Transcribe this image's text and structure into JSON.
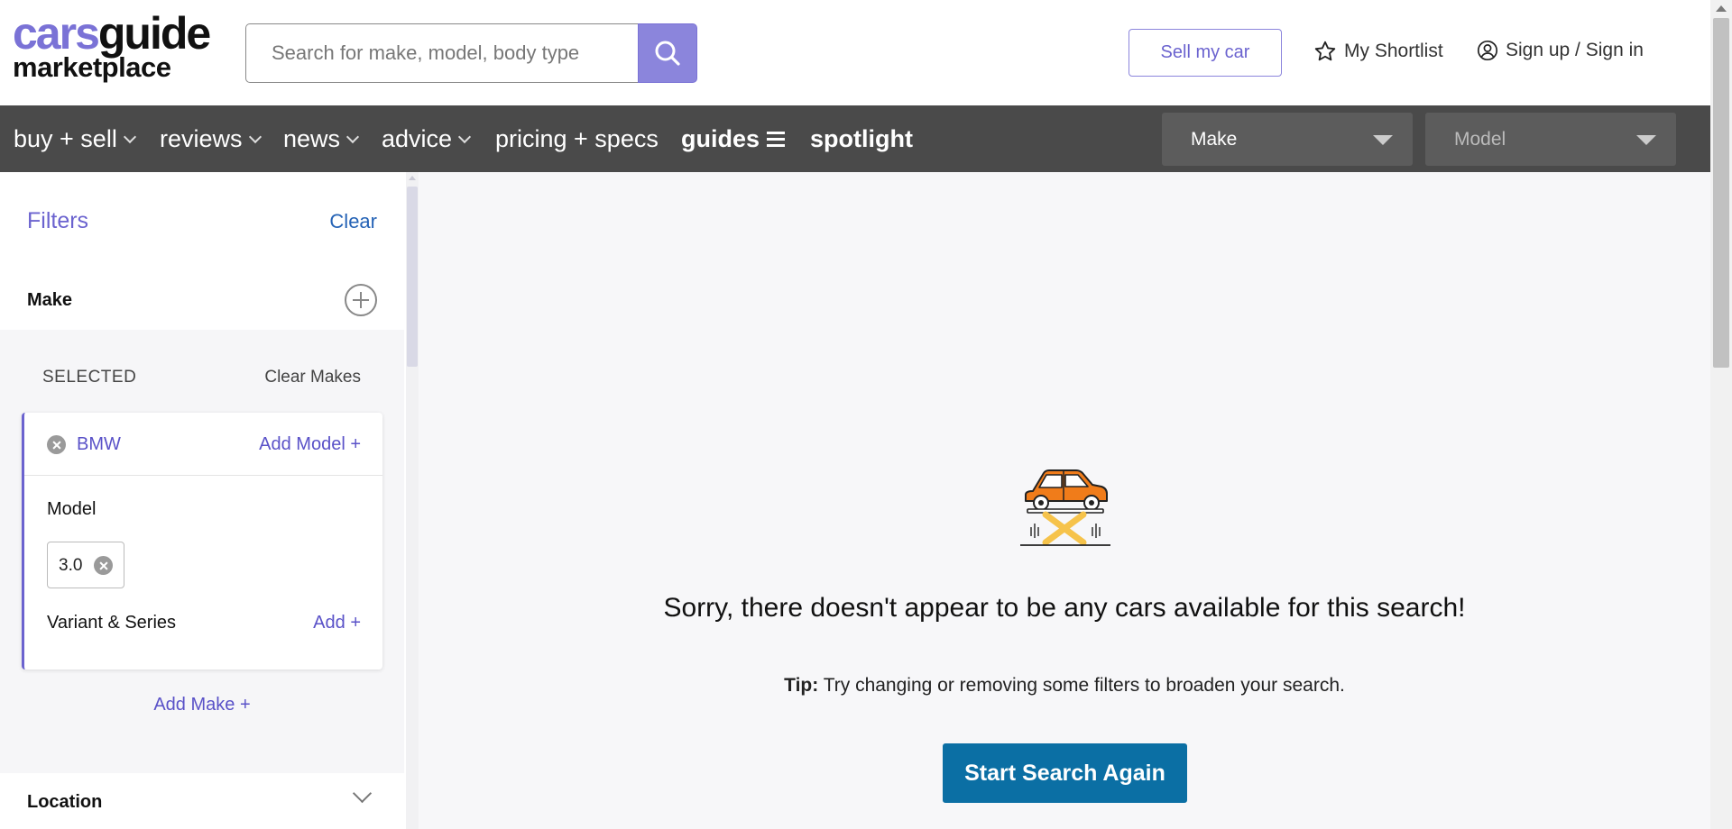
{
  "logo": {
    "part1": "cars",
    "part2": "guide",
    "line2": "marketplace"
  },
  "search": {
    "placeholder": "Search for make, model, body type"
  },
  "header": {
    "sell_label": "Sell my car",
    "shortlist_label": "My Shortlist",
    "signin_label": "Sign up / Sign in"
  },
  "nav": {
    "items": [
      {
        "label": "buy + sell"
      },
      {
        "label": "reviews"
      },
      {
        "label": "news"
      },
      {
        "label": "advice"
      },
      {
        "label": "pricing + specs"
      },
      {
        "label": "guides"
      },
      {
        "label": "spotlight"
      }
    ],
    "make_select": "Make",
    "model_select": "Model"
  },
  "sidebar": {
    "title": "Filters",
    "clear": "Clear",
    "make_label": "Make",
    "selected_label": "SELECTED",
    "clear_makes": "Clear Makes",
    "make_card": {
      "make": "BMW",
      "add_model": "Add Model +",
      "model_title": "Model",
      "model_chip": "3.0",
      "variant_label": "Variant & Series",
      "variant_add": "Add +"
    },
    "add_make": "Add Make +",
    "location_label": "Location"
  },
  "main": {
    "empty_message": "Sorry, there doesn't appear to be any cars available for this search!",
    "tip_bold": "Tip:",
    "tip_text": " Try changing or removing some filters to broaden your search.",
    "start_again": "Start Search Again"
  },
  "colors": {
    "brand_purple": "#7a72d6",
    "nav_bg": "#4a4a4a",
    "link_blue": "#2563b6",
    "cta_blue": "#0b6fa4",
    "car_orange": "#f07c1a",
    "lift_yellow": "#f6c34b"
  }
}
